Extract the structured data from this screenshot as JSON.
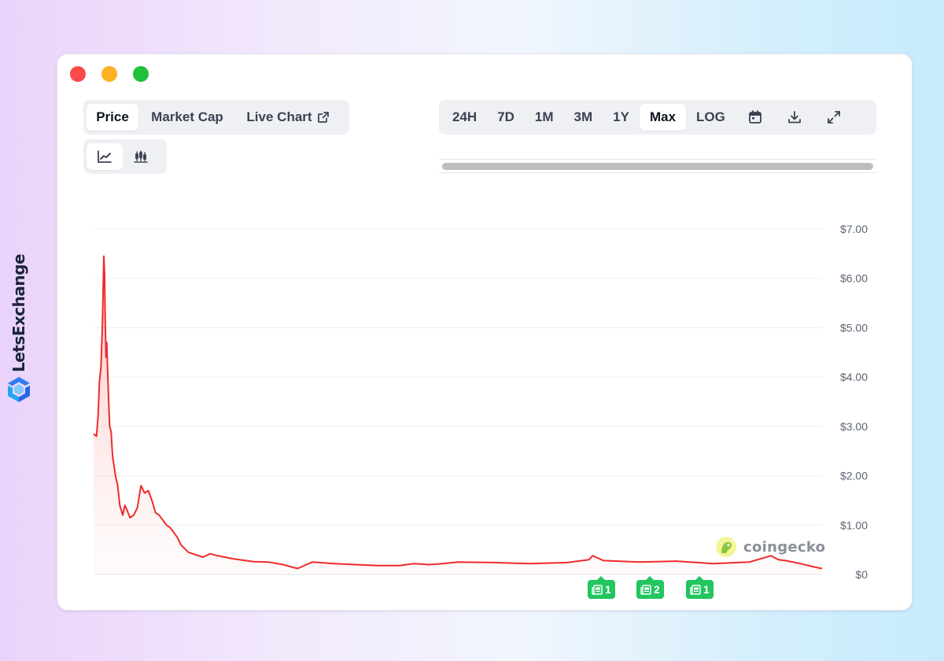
{
  "brand": {
    "name": "LetsExchange"
  },
  "tabs": {
    "price": "Price",
    "market_cap": "Market Cap",
    "live_chart": "Live Chart"
  },
  "chart_type_icons": [
    "line-chart-icon",
    "candlestick-icon"
  ],
  "ranges": [
    "24H",
    "7D",
    "1M",
    "3M",
    "1Y",
    "Max",
    "LOG"
  ],
  "active_range": "Max",
  "toolbar_icons": [
    "calendar-icon",
    "download-icon",
    "fullscreen-icon"
  ],
  "watermark": "coingecko",
  "news_markers": [
    {
      "count": "1"
    },
    {
      "count": "2"
    },
    {
      "count": "1"
    }
  ],
  "colors": {
    "line": "#ef2b2b",
    "area": "#fde2e2",
    "news": "#22c55e",
    "active_tab_bg": "#ffffff"
  },
  "chart_data": {
    "type": "area",
    "y_tick_labels": [
      "$7.00",
      "$6.00",
      "$5.00",
      "$4.00",
      "$3.00",
      "$2.00",
      "$1.00",
      "$0"
    ],
    "ylim": [
      0,
      7
    ],
    "x_axis_labels": "none",
    "grid": true,
    "series": [
      {
        "x": [
          0,
          0.4,
          0.6,
          0.8,
          1.0,
          1.2,
          1.4,
          1.5,
          1.6,
          1.7,
          1.8,
          2.0,
          2.2,
          2.4,
          2.6,
          3.0,
          3.3,
          3.6,
          4.0,
          4.3,
          4.6,
          5.0,
          5.5,
          6.0,
          6.5,
          7.0,
          7.5,
          8.0,
          8.5,
          9.0,
          9.5,
          10.0,
          10.5,
          11.0,
          11.5,
          12.0,
          13.0,
          14.0,
          15.0,
          16.0,
          17.0,
          18.0,
          19.0,
          20.0,
          22.0,
          24.0,
          26.0,
          28.0,
          30.0,
          33.0,
          36.0,
          39.0,
          42.0,
          44.0,
          46.0,
          48.0,
          50.0,
          55.0,
          60.0,
          65.0,
          68.0,
          68.5,
          70.0,
          75.0,
          80.0,
          85.0,
          90.0,
          93.0,
          94.0,
          95.0,
          97.0,
          99.0,
          100.0
        ],
        "y": [
          2.85,
          2.8,
          3.2,
          3.9,
          4.2,
          5.0,
          6.45,
          6.1,
          5.1,
          4.4,
          4.7,
          3.8,
          3.0,
          2.9,
          2.4,
          2.0,
          1.8,
          1.4,
          1.2,
          1.4,
          1.3,
          1.15,
          1.2,
          1.35,
          1.8,
          1.65,
          1.7,
          1.5,
          1.25,
          1.2,
          1.1,
          1.0,
          0.95,
          0.85,
          0.75,
          0.6,
          0.45,
          0.4,
          0.35,
          0.42,
          0.38,
          0.35,
          0.32,
          0.3,
          0.26,
          0.25,
          0.2,
          0.12,
          0.25,
          0.22,
          0.2,
          0.18,
          0.18,
          0.22,
          0.2,
          0.22,
          0.25,
          0.24,
          0.22,
          0.24,
          0.3,
          0.38,
          0.28,
          0.25,
          0.27,
          0.22,
          0.25,
          0.38,
          0.3,
          0.28,
          0.22,
          0.15,
          0.12
        ]
      }
    ]
  }
}
